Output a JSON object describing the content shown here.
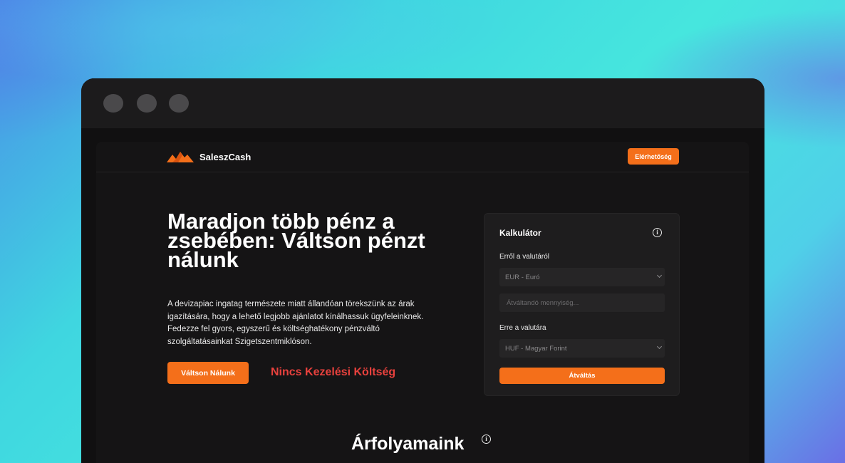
{
  "brand": {
    "name": "SaleszCash",
    "accent_color": "#f46f1a",
    "logo_icon": "mountain-logo-icon"
  },
  "nav": {
    "contact_label": "Elérhetőség"
  },
  "hero": {
    "title": "Maradjon több pénz a zsebében: Váltson pénzt nálunk",
    "text": "A devizapiac ingatag természete miatt állandóan törekszünk az árak igazítására, hogy a lehető legjobb ajánlatot kínálhassuk ügyfeleinknek. Fedezze fel gyors, egyszerű és költséghatékony pénzváltó szolgáltatásainkat Szigetszentmiklóson.",
    "cta_label": "Váltson Nálunk",
    "no_fee_label": "Nincs Kezelési Költség",
    "no_fee_color": "#e8413d"
  },
  "calculator": {
    "title": "Kalkulátor",
    "info_icon": "info-icon",
    "from_label": "Erről a valutáról",
    "from_value": "EUR - Euró",
    "amount_placeholder": "Átváltandó mennyiség...",
    "to_label": "Erre a valutára",
    "to_value": "HUF - Magyar Forint",
    "convert_label": "Átváltás"
  },
  "rates": {
    "title": "Árfolyamaink",
    "info_icon": "info-icon"
  }
}
